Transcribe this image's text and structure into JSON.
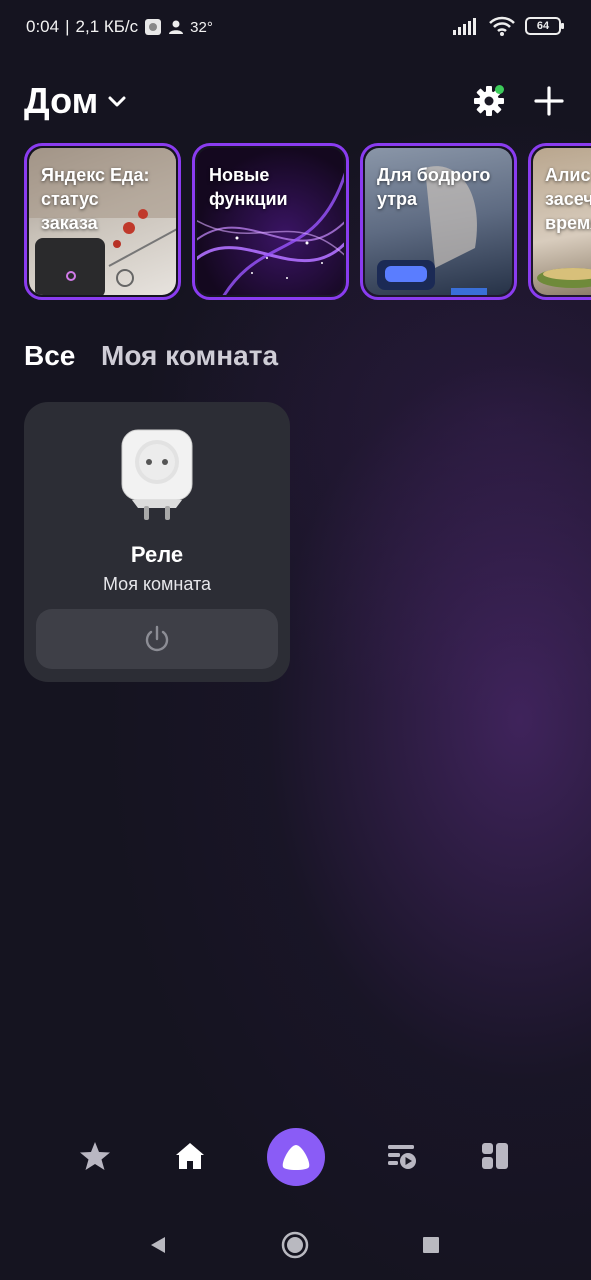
{
  "status_bar": {
    "time": "0:04",
    "separator": "|",
    "speed": "2,1 КБ/с",
    "temperature": "32°",
    "battery": "64"
  },
  "header": {
    "title": "Дом",
    "title_icon": "chevron-down-icon",
    "settings_icon": "gear-icon",
    "add_icon": "plus-icon",
    "notification_dot_color": "#3ccb5a"
  },
  "stories": [
    {
      "label": "Яндекс Еда:\nстатус\nзаказа"
    },
    {
      "label": "Новые\nфункции"
    },
    {
      "label": "Для бодрого\nутра"
    },
    {
      "label": "Алис\nзасеч\nвремя"
    }
  ],
  "tabs": {
    "all": "Все",
    "room": "Моя комната"
  },
  "device": {
    "name": "Реле",
    "room": "Моя комната",
    "power_icon": "power-icon"
  },
  "bottom_nav": {
    "items": [
      "star-icon",
      "home-icon",
      "alice-icon",
      "scenarios-icon",
      "dashboard-icon"
    ],
    "accent": "#8a5cf6"
  },
  "system_nav": [
    "back-icon",
    "home-circle-icon",
    "recents-icon"
  ]
}
